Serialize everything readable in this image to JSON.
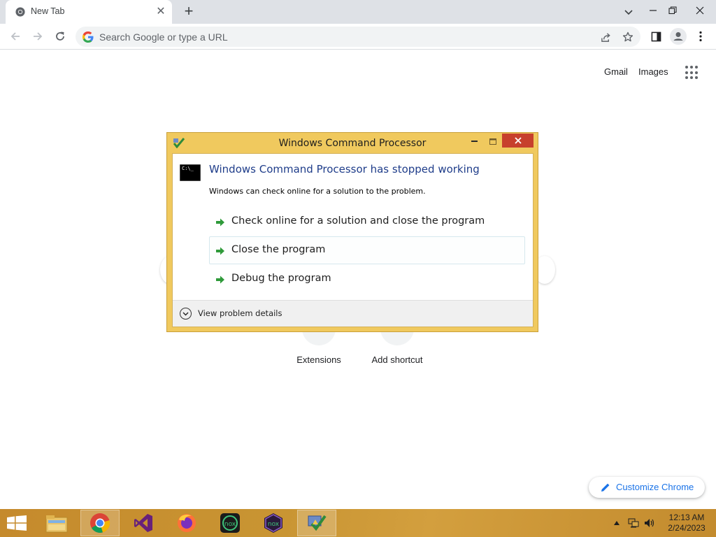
{
  "browser": {
    "tab": {
      "title": "New Tab",
      "close_glyph": "✕"
    },
    "new_tab_glyph": "+",
    "omnibox": {
      "placeholder": "Search Google or type a URL"
    },
    "icons": [
      "chrome-favicon",
      "back-arrow-icon",
      "forward-arrow-icon",
      "reload-icon",
      "google-g-icon",
      "share-icon",
      "bookmark-star-icon",
      "side-panel-icon",
      "profile-icon",
      "kebab-menu-icon",
      "tab-search-icon",
      "minimize-icon",
      "restore-icon",
      "window-close-icon"
    ]
  },
  "ntp": {
    "header_links": {
      "gmail": "Gmail",
      "images": "Images"
    },
    "shortcuts": [
      {
        "label": "Extensions"
      },
      {
        "label": "Add shortcut"
      }
    ],
    "customize_label": "Customize Chrome",
    "accent_color": "#1a73e8"
  },
  "dialog": {
    "title": "Windows Command Processor",
    "cmd_icon_text": "C:\\_",
    "heading": "Windows Command Processor has stopped working",
    "subtext": "Windows can check online for a solution to the problem.",
    "options": [
      {
        "label": "Check online for a solution and close the program"
      },
      {
        "label": "Close the program"
      },
      {
        "label": "Debug the program"
      }
    ],
    "details_label": "View problem details",
    "frame_color": "#f0c95e",
    "close_color": "#c7402d"
  },
  "taskbar": {
    "apps": [
      "windows-start-icon",
      "file-explorer-icon",
      "chrome-icon",
      "visual-studio-icon",
      "firefox-icon",
      "nox-icon",
      "nox-multi-icon",
      "error-reporting-icon"
    ],
    "clock": {
      "time": "12:13 AM",
      "date": "2/24/2023"
    }
  }
}
